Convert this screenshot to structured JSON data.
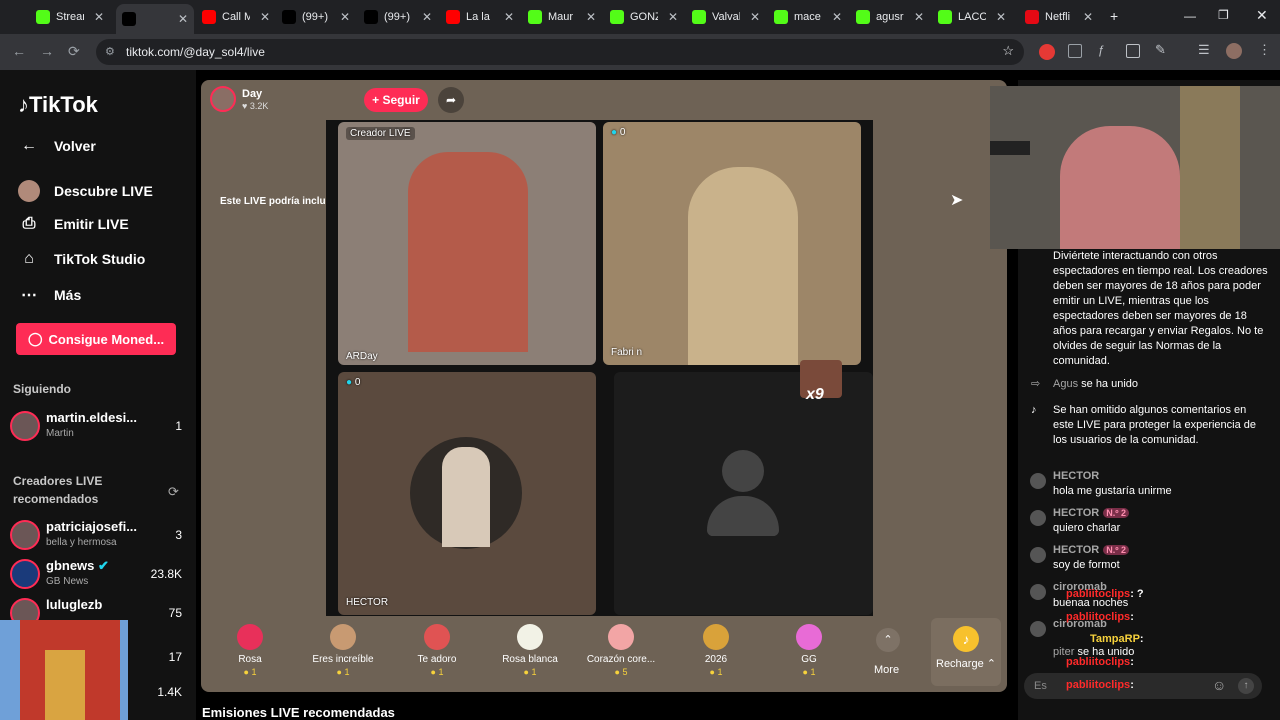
{
  "browser": {
    "tabs": [
      {
        "label": "Stream",
        "icon": "kick-icon",
        "color": "#53fc18"
      },
      {
        "label": "",
        "icon": "tiktok-icon",
        "color": "#000000",
        "active": true
      },
      {
        "label": "Call M",
        "icon": "youtube-icon",
        "color": "#ff0000"
      },
      {
        "label": "(99+)",
        "icon": "tiktok-icon",
        "color": "#000000"
      },
      {
        "label": "(99+)",
        "icon": "tiktok-icon",
        "color": "#000000"
      },
      {
        "label": "La la",
        "icon": "youtube-icon",
        "color": "#ff0000"
      },
      {
        "label": "Maur",
        "icon": "kick-icon",
        "color": "#53fc18"
      },
      {
        "label": "GONZ",
        "icon": "kick-icon",
        "color": "#53fc18"
      },
      {
        "label": "Valval",
        "icon": "kick-icon",
        "color": "#53fc18"
      },
      {
        "label": "mace",
        "icon": "kick-icon",
        "color": "#53fc18"
      },
      {
        "label": "agusr",
        "icon": "kick-icon",
        "color": "#53fc18"
      },
      {
        "label": "LACO",
        "icon": "kick-icon",
        "color": "#53fc18"
      },
      {
        "label": "Netfli",
        "icon": "netflix-icon",
        "color": "#e50914"
      }
    ],
    "new_tab": "+",
    "url": "tiktok.com/@day_sol4/live"
  },
  "sidebar": {
    "logo": "TikTok",
    "nav": [
      {
        "label": "Volver",
        "icon": "arrow-left-icon"
      },
      {
        "label": "Descubre LIVE",
        "icon": "avatar-live-icon"
      },
      {
        "label": "Emitir LIVE",
        "icon": "camera-icon"
      },
      {
        "label": "TikTok Studio",
        "icon": "studio-icon"
      },
      {
        "label": "Más",
        "icon": "more-icon"
      }
    ],
    "coins_button": "Consigue Moned...",
    "following_title": "Siguiendo",
    "following": [
      {
        "name": "martin.eldesi...",
        "sub": "Martin",
        "count": "1"
      }
    ],
    "recommended_title": "Creadores LIVE recomendados",
    "recommended": [
      {
        "name": "patriciajosefi...",
        "sub": "bella y hermosa",
        "count": "3"
      },
      {
        "name": "gbnews",
        "sub": "GB News",
        "count": "23.8K",
        "verified": true
      },
      {
        "name": "luluglezb",
        "sub": "",
        "count": "75"
      },
      {
        "name": "",
        "sub": "",
        "count": "17"
      },
      {
        "name": "",
        "sub": "",
        "count": "1.4K"
      }
    ]
  },
  "live": {
    "host_name": "Day",
    "viewers": "3.2K",
    "follow_label": "+ Seguir",
    "ai_notice": "Este LIVE podría incluir contenido generado por IA",
    "cells": [
      {
        "label": "Creador LIVE",
        "footer": "ARDay"
      },
      {
        "label": "0",
        "footer": "Fabri n"
      },
      {
        "label": "0",
        "footer": "HECTOR"
      },
      {
        "label": "",
        "footer": ""
      }
    ],
    "multiplier": "x9",
    "gifts": [
      {
        "name": "Rosa",
        "price": "1",
        "color": "#e8305a"
      },
      {
        "name": "Eres increíble",
        "price": "1",
        "color": "#c89a72"
      },
      {
        "name": "Te adoro",
        "price": "1",
        "color": "#e05353"
      },
      {
        "name": "Rosa blanca",
        "price": "1",
        "color": "#f2f2e6"
      },
      {
        "name": "Corazón core...",
        "price": "5",
        "color": "#f2a5a5"
      },
      {
        "name": "2026",
        "price": "1",
        "color": "#d9a23a"
      },
      {
        "name": "GG",
        "price": "1",
        "color": "#e86bd6"
      }
    ],
    "more_label": "More",
    "recharge_label": "Recharge",
    "bottom_title": "Emisiones LIVE recomendadas"
  },
  "chat": {
    "intro": "Diviértete interactuando con otros espectadores en tiempo real. Los creadores deben ser mayores de 18 años para poder emitir un LIVE, mientras que los espectadores deben ser mayores de 18 años para recargar y enviar Regalos. No te olvides de seguir las Normas de la comunidad.",
    "join_name": "Agus",
    "join_text": "se ha unido",
    "omitted": "Se han omitido algunos comentarios en este LIVE para proteger la experiencia de los usuarios de la comunidad.",
    "messages": [
      {
        "name": "HECTOR",
        "badge": "",
        "text": "hola me gustaría unirme"
      },
      {
        "name": "HECTOR",
        "badge": "N.º 2",
        "text": "quiero charlar"
      },
      {
        "name": "HECTOR",
        "badge": "N.º 2",
        "text": "soy de formot"
      }
    ],
    "extra": [
      {
        "name": "ciroromab",
        "text": "buenaa noches"
      },
      {
        "name": "ciroromab",
        "text": ""
      },
      {
        "name": "piter",
        "text": "se ha unido"
      }
    ],
    "input_placeholder": "Es",
    "stream_overlay": [
      {
        "user": "pabliitoclips",
        "msg": ": ?"
      },
      {
        "user": "pabliitoclips",
        "msg": ":"
      },
      {
        "user": "TampaRP",
        "msg": ":"
      },
      {
        "user": "pabliitoclips",
        "msg": ":"
      },
      {
        "user": "pabliitoclips",
        "msg": ":"
      }
    ]
  },
  "colors": {
    "accent": "#fe2c55",
    "panel": "#6e6255",
    "gold": "#f7d23c"
  }
}
